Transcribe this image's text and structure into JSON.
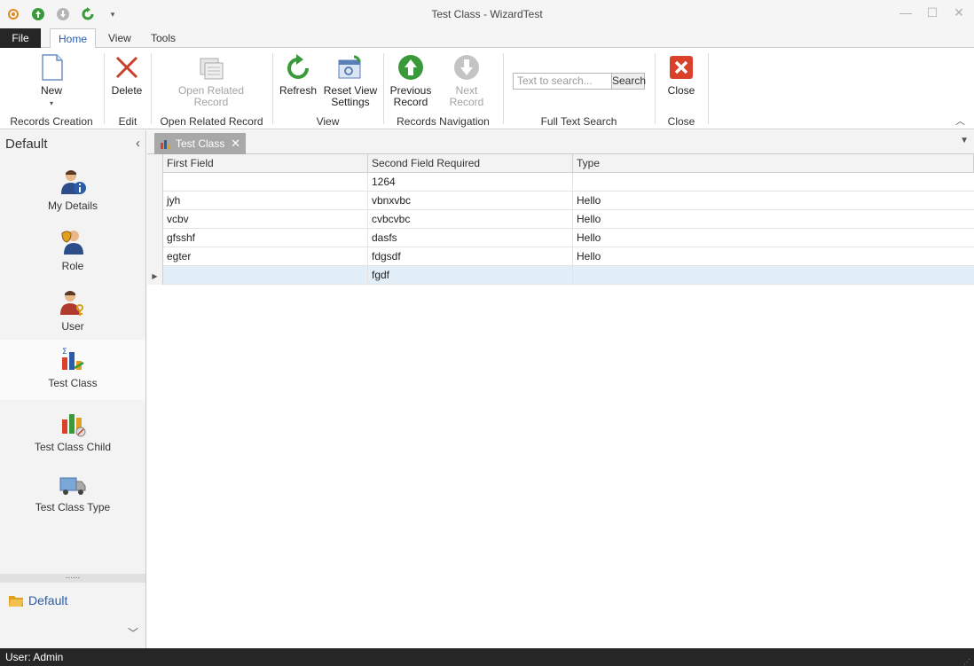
{
  "window": {
    "title": "Test Class - WizardTest",
    "controls": [
      "—",
      "☐",
      "✕"
    ]
  },
  "ribbon_tabs": {
    "file": "File",
    "home": "Home",
    "view": "View",
    "tools": "Tools"
  },
  "ribbon": {
    "new": "New",
    "delete": "Delete",
    "open_related_line1": "Open Related",
    "open_related_line2": "Record",
    "refresh": "Refresh",
    "reset_line1": "Reset View",
    "reset_line2": "Settings",
    "previous_line1": "Previous",
    "previous_line2": "Record",
    "next_record": "Next Record",
    "search_placeholder": "Text to search...",
    "search_button": "Search",
    "close": "Close",
    "groups": {
      "records_creation": "Records Creation",
      "edit": "Edit",
      "open_related": "Open Related Record",
      "view": "View",
      "navigation": "Records Navigation",
      "full_text_search": "Full Text Search",
      "close": "Close"
    }
  },
  "nav": {
    "header": "Default",
    "items": [
      {
        "label": "My Details"
      },
      {
        "label": "Role"
      },
      {
        "label": "User"
      },
      {
        "label": "Test Class"
      },
      {
        "label": "Test Class Child"
      },
      {
        "label": "Test Class Type"
      }
    ],
    "group": "Default"
  },
  "document": {
    "tab": "Test Class"
  },
  "grid": {
    "columns": [
      "First Field",
      "Second Field Required",
      "Type"
    ],
    "rows": [
      [
        "",
        "1264",
        ""
      ],
      [
        "jyh",
        "vbnxvbc",
        "Hello"
      ],
      [
        "vcbv",
        "cvbcvbc",
        "Hello"
      ],
      [
        "gfsshf",
        "dasfs",
        "Hello"
      ],
      [
        "egter",
        "fdgsdf",
        "Hello"
      ],
      [
        "",
        "fgdf",
        ""
      ]
    ]
  },
  "status": {
    "user": "User: Admin"
  },
  "colors": {
    "accent": "#2a5ca8",
    "dark": "#262626",
    "selection": "#e2eef8"
  }
}
